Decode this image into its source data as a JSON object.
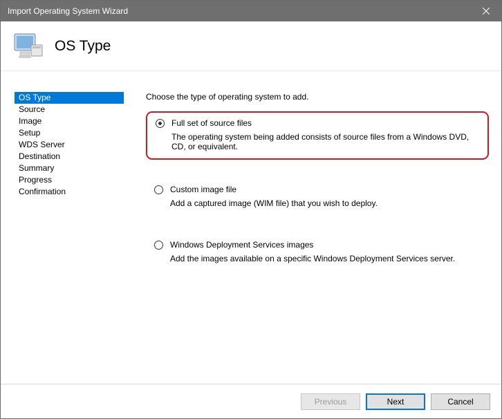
{
  "window": {
    "title": "Import Operating System Wizard"
  },
  "header": {
    "title": "OS Type"
  },
  "sidebar": {
    "steps": [
      {
        "label": "OS Type",
        "selected": true
      },
      {
        "label": "Source",
        "selected": false
      },
      {
        "label": "Image",
        "selected": false
      },
      {
        "label": "Setup",
        "selected": false
      },
      {
        "label": "WDS Server",
        "selected": false
      },
      {
        "label": "Destination",
        "selected": false
      },
      {
        "label": "Summary",
        "selected": false
      },
      {
        "label": "Progress",
        "selected": false
      },
      {
        "label": "Confirmation",
        "selected": false
      }
    ]
  },
  "content": {
    "prompt": "Choose the type of operating system to add.",
    "options": [
      {
        "label": "Full set of source files",
        "description": "The operating system being added consists of source files from a Windows DVD, CD, or equivalent.",
        "checked": true,
        "highlighted": true
      },
      {
        "label": "Custom image file",
        "description": "Add a captured image (WIM file) that you wish to deploy.",
        "checked": false,
        "highlighted": false
      },
      {
        "label": "Windows Deployment Services images",
        "description": "Add the images available on a specific Windows Deployment Services server.",
        "checked": false,
        "highlighted": false
      }
    ]
  },
  "footer": {
    "previous": "Previous",
    "next": "Next",
    "cancel": "Cancel"
  }
}
